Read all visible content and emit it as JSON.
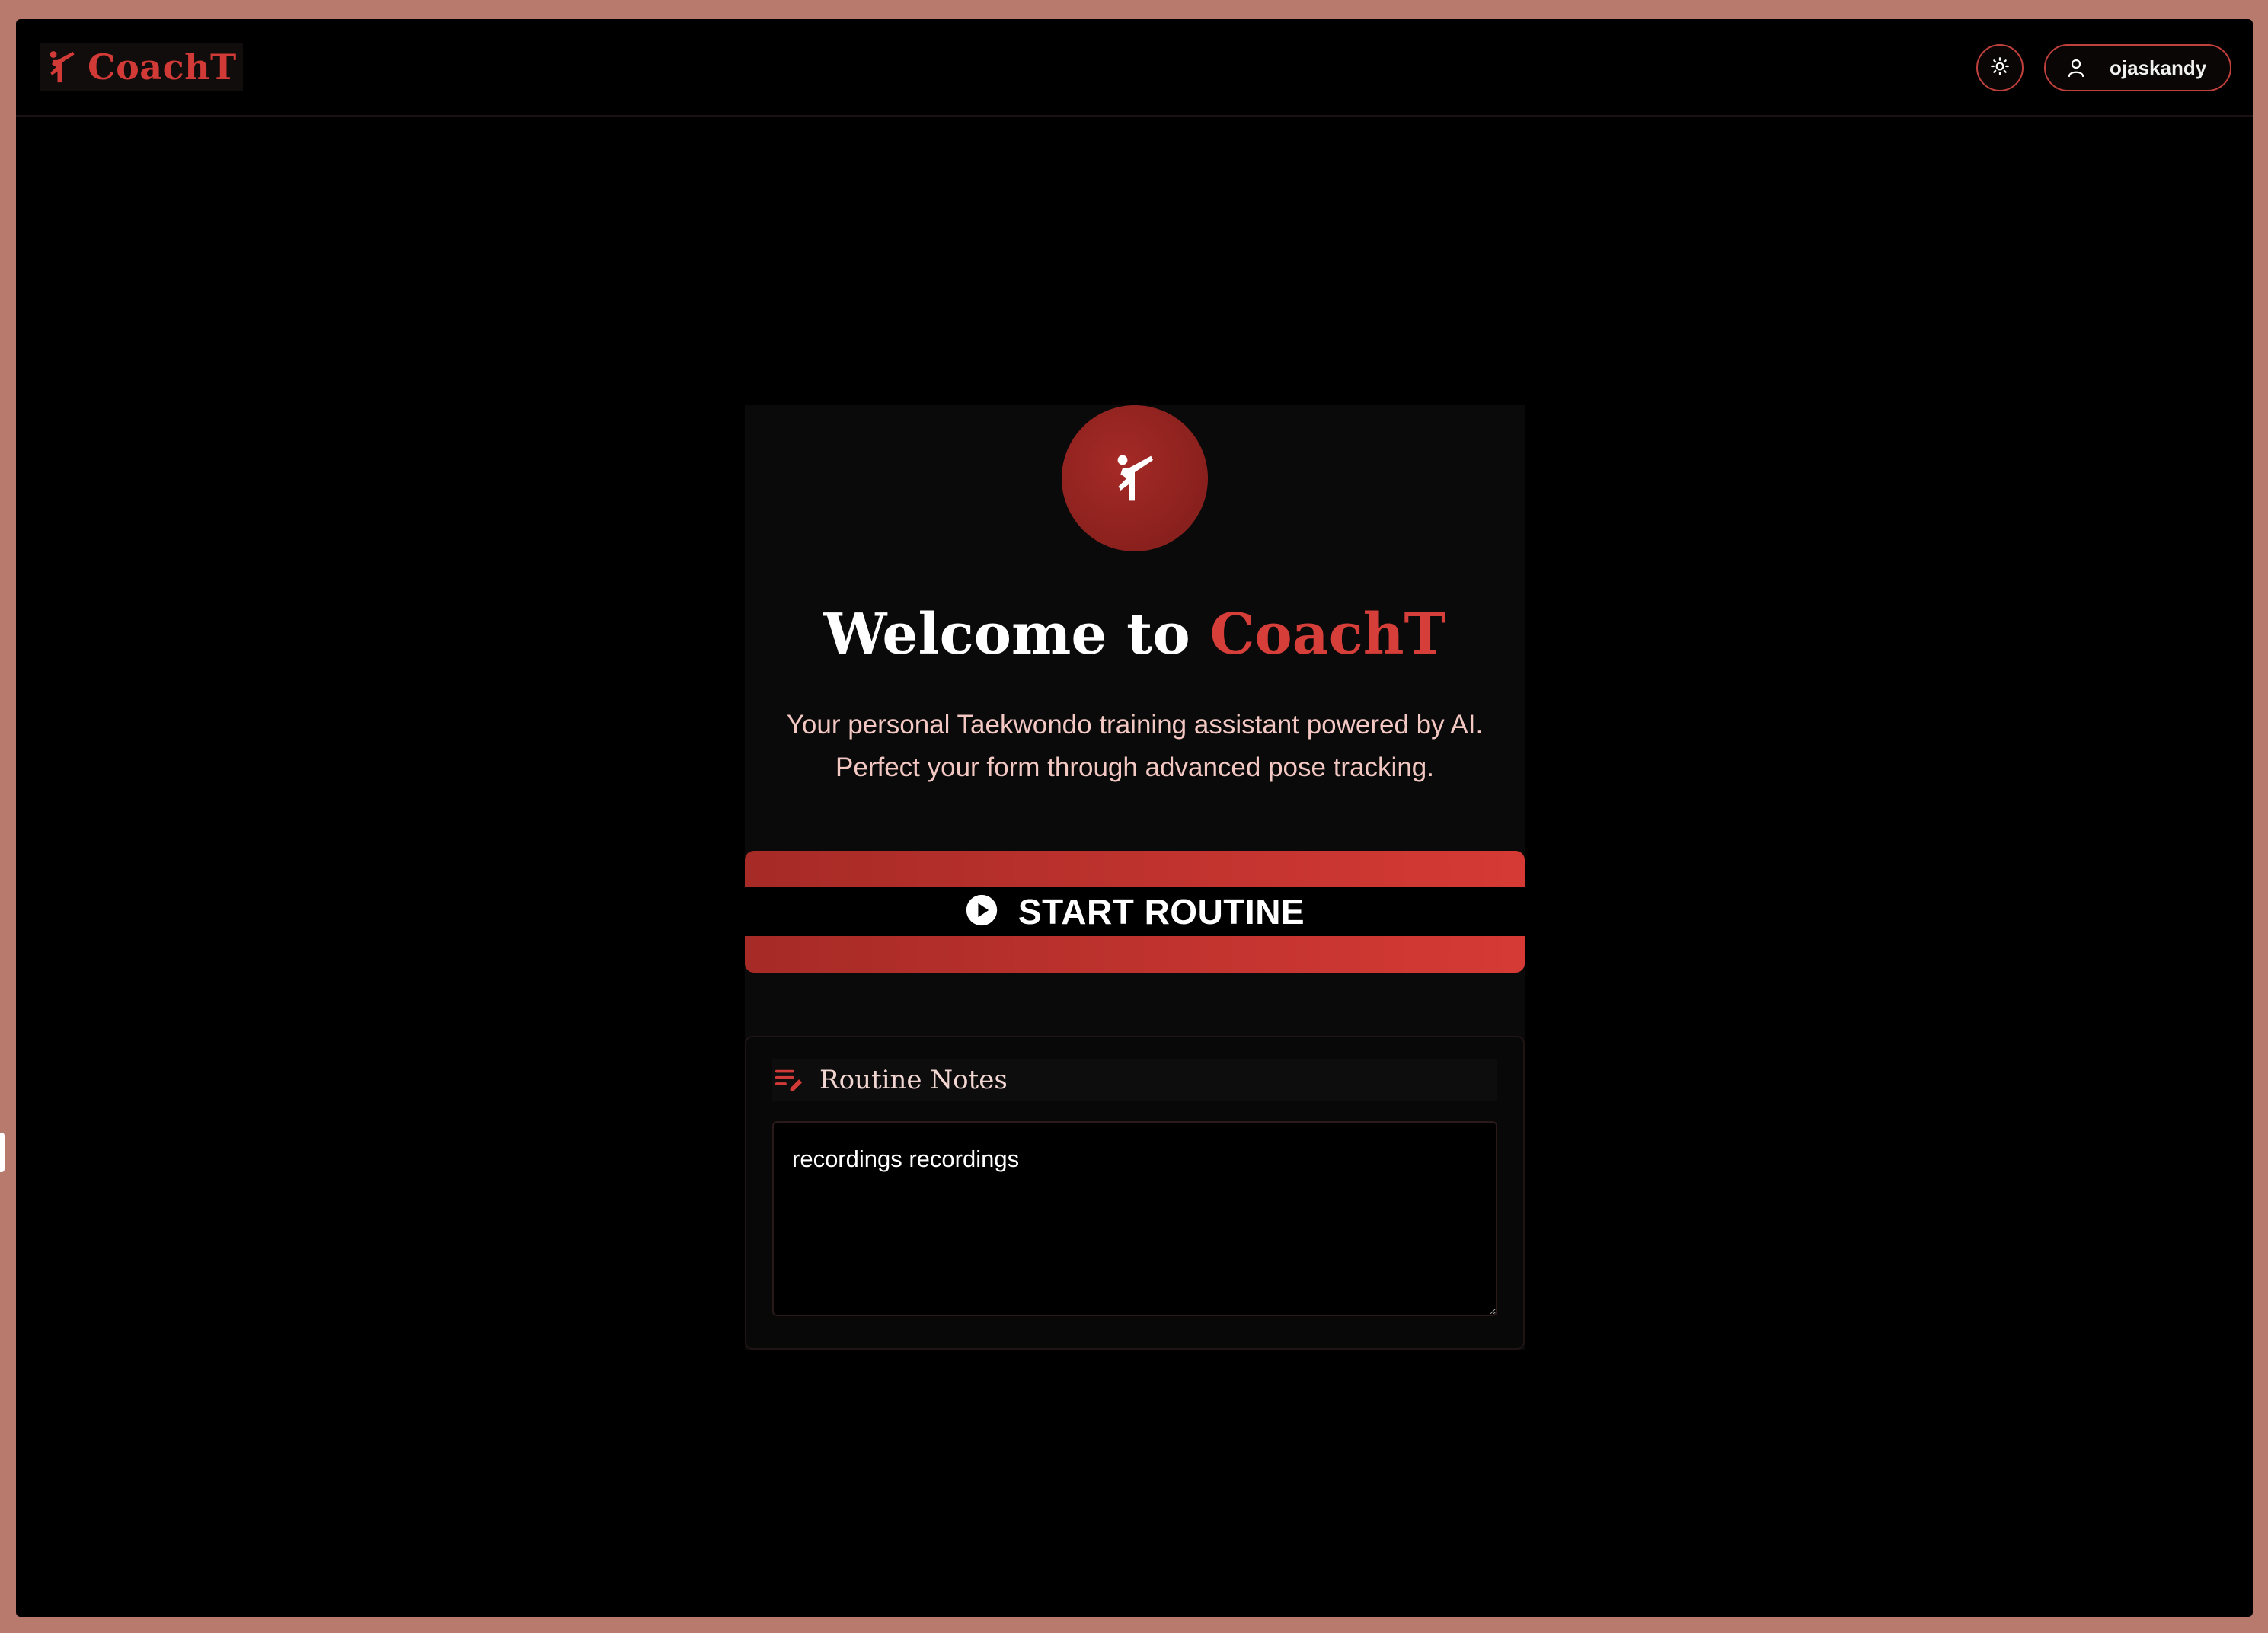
{
  "app": {
    "brand_name": "CoachT"
  },
  "header": {
    "theme_toggle_icon": "sun-icon",
    "user": {
      "name": "ojaskandy",
      "icon": "user-icon"
    }
  },
  "hero": {
    "icon": "martial-arts-kick-icon",
    "title_prefix": "Welcome to ",
    "title_accent": "CoachT",
    "subtitle_line1": "Your personal Taekwondo training assistant powered by AI.",
    "subtitle_line2": "Perfect your form through advanced pose tracking."
  },
  "start_button": {
    "label": "START ROUTINE",
    "icon": "play-circle-icon"
  },
  "notes": {
    "title": "Routine Notes",
    "icon": "edit-notes-icon",
    "value": "recordings recordings"
  },
  "colors": {
    "accent": "#d63e39",
    "accent_dark": "#a62a26",
    "background": "#000000",
    "card": "#0a0a0a",
    "frame": "#b87a6c"
  }
}
